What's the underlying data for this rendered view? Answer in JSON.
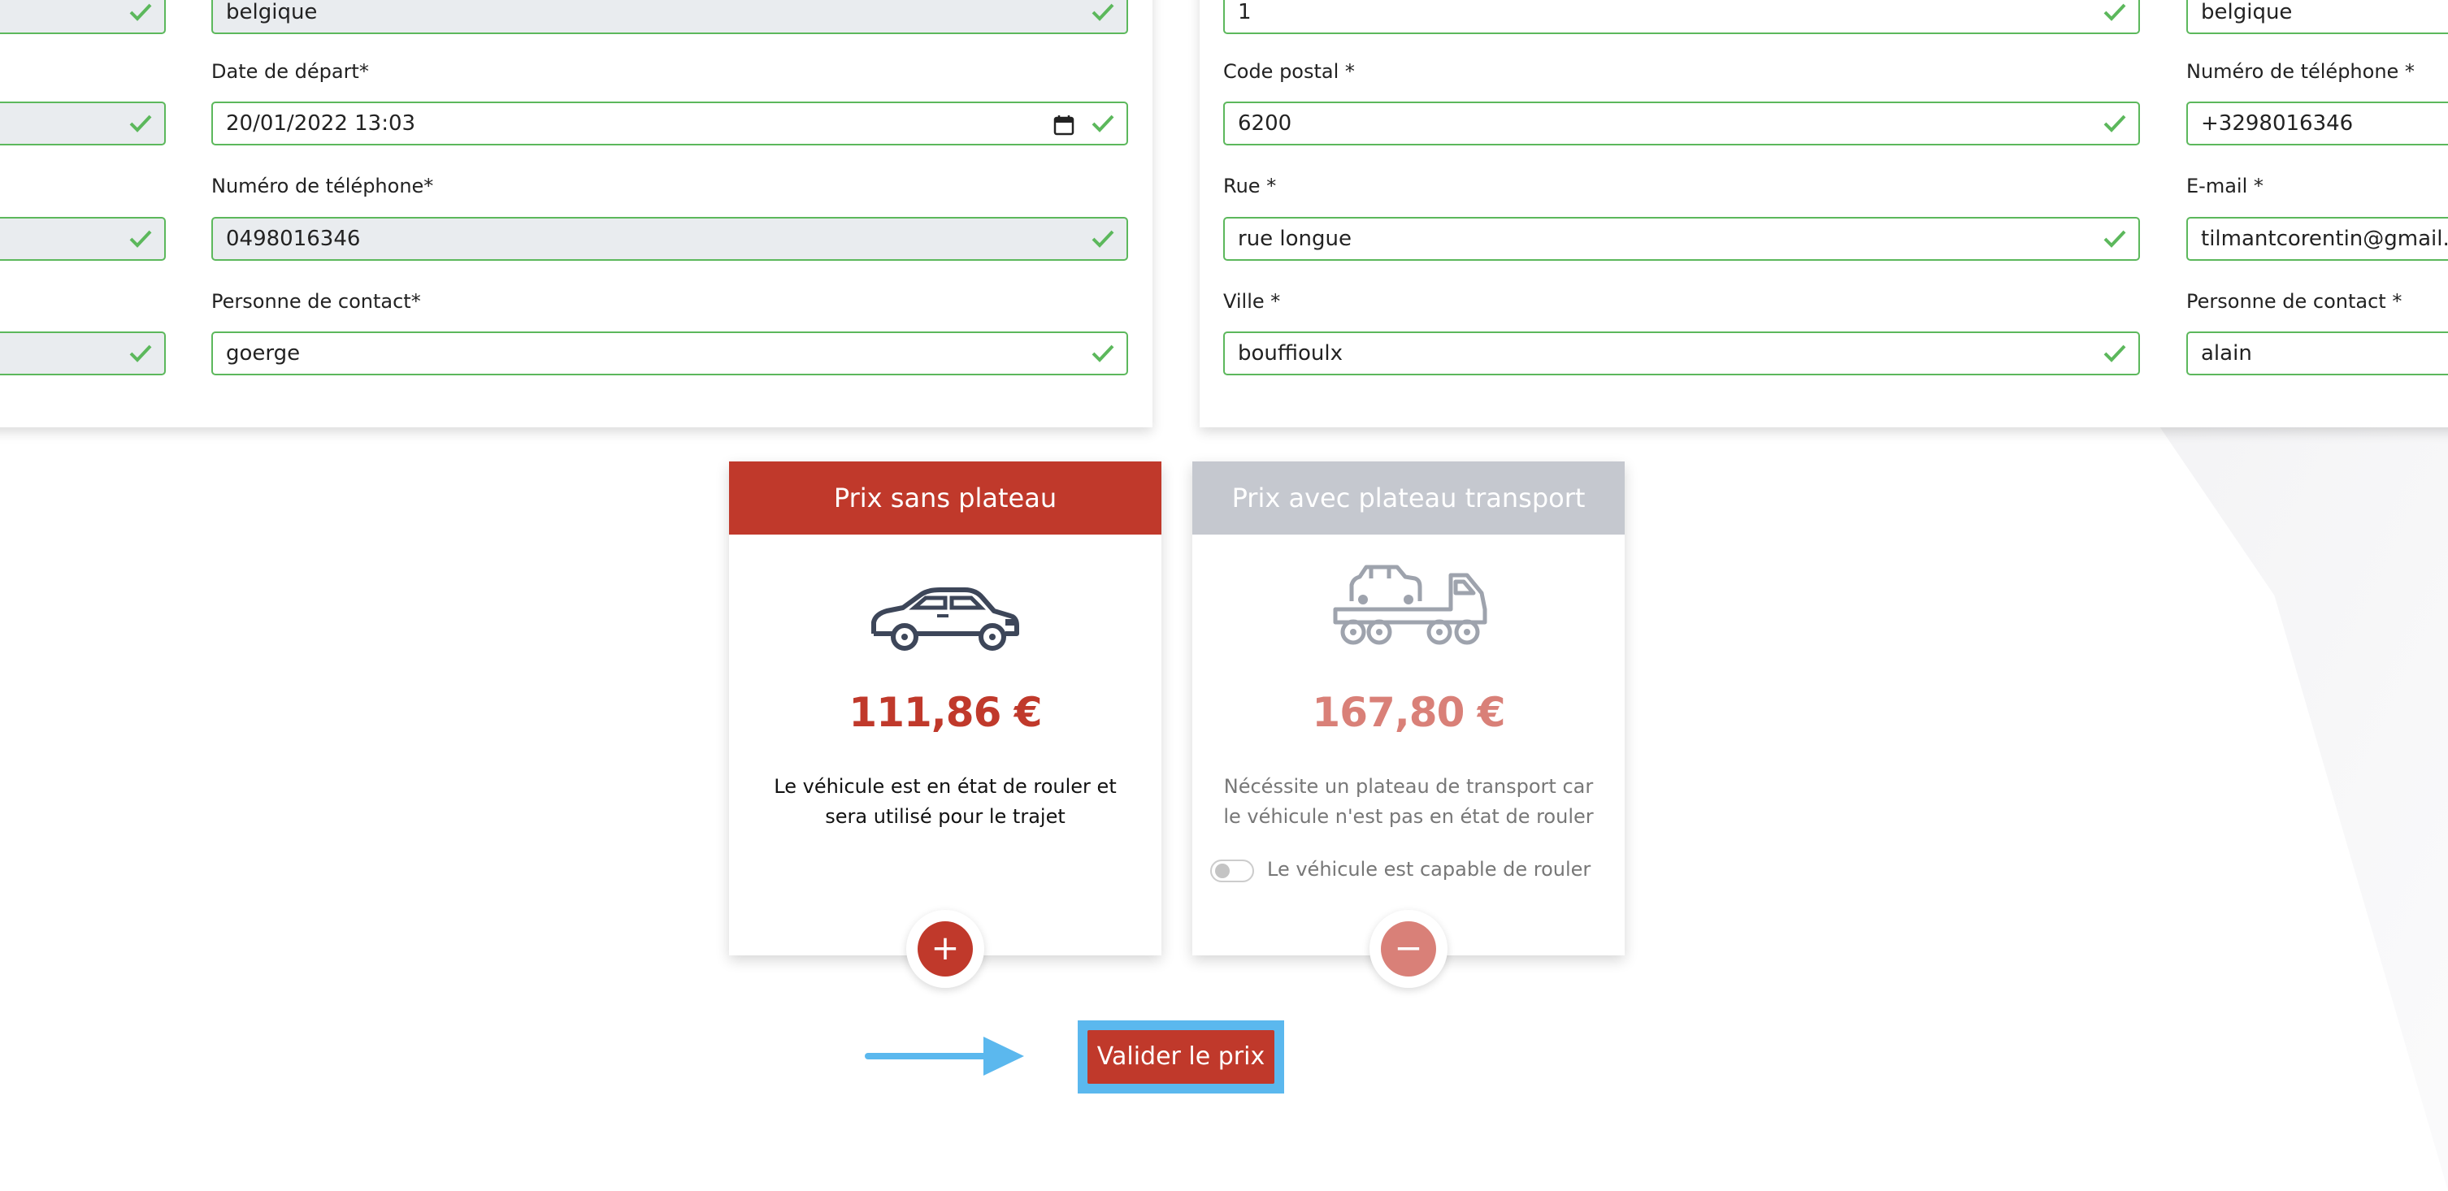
{
  "left_form": {
    "country_value": "belgique",
    "date_label": "Date de départ*",
    "date_value": "20/01/2022 13:03",
    "phone_label": "Numéro de téléphone*",
    "phone_value": "0498016346",
    "contact_label": "Personne de contact*",
    "contact_value": "goerge"
  },
  "middle_form": {
    "number_value": "1",
    "postal_label": "Code postal *",
    "postal_value": "6200",
    "street_label": "Rue *",
    "street_value": "rue longue",
    "city_label": "Ville *",
    "city_value": "bouffioulx"
  },
  "right_form": {
    "country_value": "belgique",
    "phone_label": "Numéro de téléphone *",
    "phone_value": "+3298016346",
    "email_label": "E-mail *",
    "email_value": "tilmantcorentin@gmail.co",
    "contact_label": "Personne de contact *",
    "contact_value": "alain"
  },
  "price_cards": {
    "without": {
      "title": "Prix sans plateau",
      "amount": "111,86 €",
      "description": "Le véhicule est en état de rouler et sera utilisé pour le trajet",
      "button_symbol": "+"
    },
    "with": {
      "title": "Prix avec plateau transport",
      "amount": "167,80 €",
      "description": "Nécéssite un plateau de transport car le véhicule n'est pas en état de rouler",
      "toggle_label": "Le véhicule est capable de rouler",
      "button_symbol": "−"
    }
  },
  "actions": {
    "validate_label": "Valider le prix"
  },
  "colors": {
    "primary_red": "#c0392b",
    "disabled_header": "#c5c8cf",
    "success_green": "#5cb85c",
    "highlight_blue": "#5bb8ee"
  },
  "icons": {
    "valid": "check-icon",
    "calendar": "calendar-icon",
    "car": "car-icon",
    "tow_truck": "tow-truck-icon",
    "arrow": "arrow-right-icon"
  }
}
